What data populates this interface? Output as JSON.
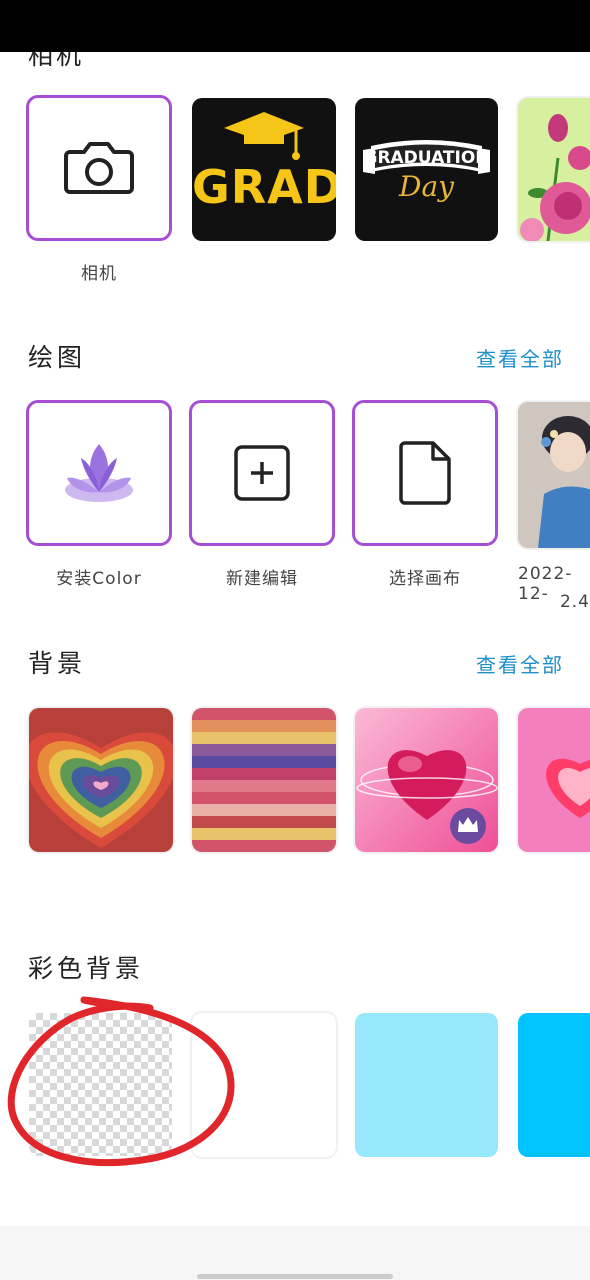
{
  "camera_section": {
    "title_clipped": "相机",
    "camera_label": "相机",
    "sticker_grad_text": "GRAD",
    "sticker_graduation_text": "GRADUATION",
    "sticker_day_text": "Day"
  },
  "drawing_section": {
    "title": "绘图",
    "view_all": "查看全部",
    "install_color_label": "安装Color",
    "new_edit_label": "新建编辑",
    "choose_canvas_label": "选择画布",
    "recent_label_line1": "2022-12-",
    "recent_label_line2": "2.4"
  },
  "background_section": {
    "title": "背景",
    "view_all": "查看全部"
  },
  "color_background_section": {
    "title": "彩色背景",
    "swatch_colors": [
      "#ffffff",
      "#97e8fb",
      "#00c3ff"
    ]
  },
  "colors": {
    "accent_purple": "#a64fd4",
    "link_blue": "#1f8fc9",
    "annotation_red": "#e0262b"
  }
}
